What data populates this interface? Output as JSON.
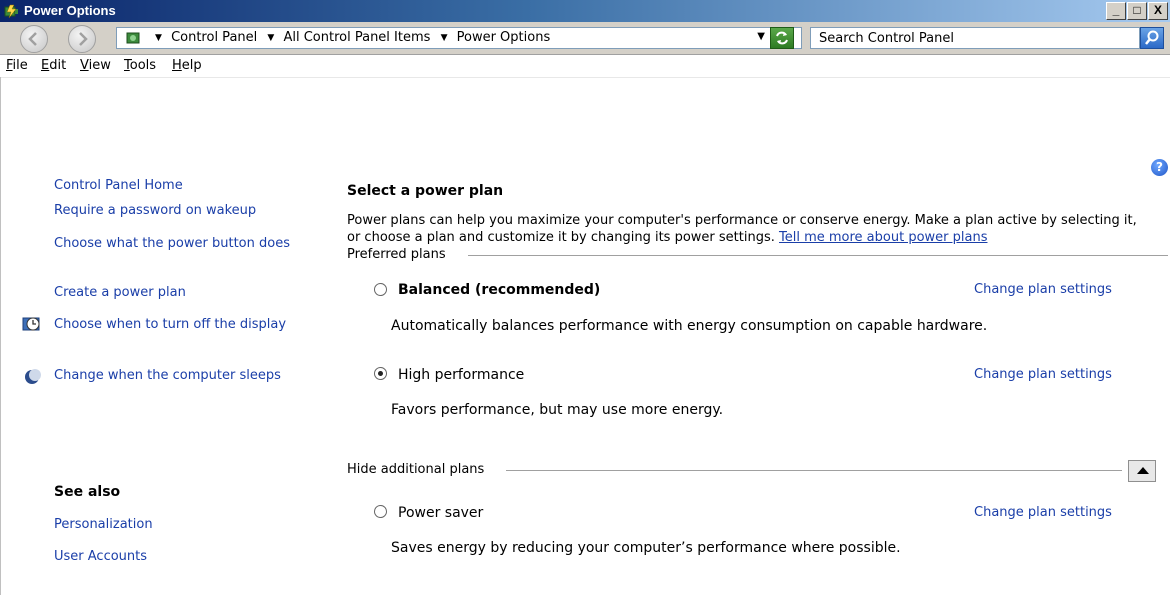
{
  "window": {
    "title": "Power Options",
    "min_glyph": "_",
    "max_glyph": "□",
    "close_glyph": "X"
  },
  "address": {
    "breadcrumbs": [
      "Control Panel",
      "All Control Panel Items",
      "Power Options"
    ],
    "search_placeholder": "Search Control Panel"
  },
  "menu": {
    "items": [
      {
        "accel": "F",
        "rest": "ile"
      },
      {
        "accel": "E",
        "rest": "dit"
      },
      {
        "accel": "V",
        "rest": "iew"
      },
      {
        "accel": "T",
        "rest": "ools"
      },
      {
        "accel": "H",
        "rest": "elp"
      }
    ]
  },
  "sidebar": {
    "home": "Control Panel Home",
    "links": [
      "Require a password on wakeup",
      "Choose what the power button does",
      "Create a power plan",
      "Choose when to turn off the display",
      "Change when the computer sleeps"
    ],
    "see_also_title": "See also",
    "see_also": [
      "Personalization",
      "User Accounts"
    ]
  },
  "main": {
    "heading": "Select a power plan",
    "intro": "Power plans can help you maximize your computer's performance or conserve energy. Make a plan active by selecting it, or choose a plan and customize it by changing its power settings.",
    "intro_link": "Tell me more about power plans",
    "preferred_label": "Preferred plans",
    "additional_label": "Hide additional plans",
    "change_label": "Change plan settings",
    "help_glyph": "?",
    "plans": [
      {
        "name": "Balanced (recommended)",
        "desc": "Automatically balances performance with energy consumption on capable hardware.",
        "selected": false
      },
      {
        "name": "High performance",
        "desc": "Favors performance, but may use more energy.",
        "selected": true
      },
      {
        "name": "Power saver",
        "desc": "Saves energy by reducing your computer’s performance where possible.",
        "selected": false
      }
    ]
  },
  "colors": {
    "link": "#1a3ea8",
    "titlebar_start": "#0a246a",
    "titlebar_end": "#a6caf0"
  }
}
